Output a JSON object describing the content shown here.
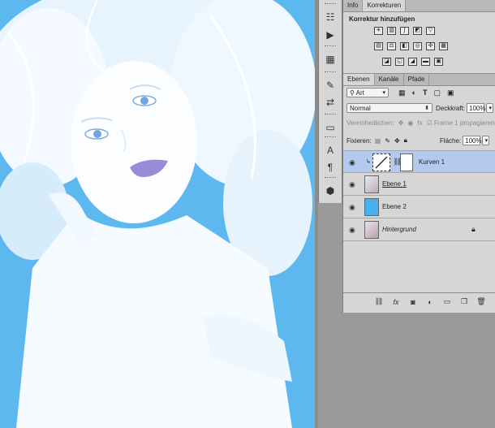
{
  "colors": {
    "canvas_bg": "#5db8f0",
    "panel_bg": "#d6d6d6",
    "selection": "#b3c9ee"
  },
  "tool_icons": [
    "actions-icon",
    "play-icon",
    "brush-preset-icon",
    "clone-source-icon",
    "character-icon",
    "paragraph-icon",
    "3d-icon"
  ],
  "top_panel": {
    "tabs": [
      "Info",
      "Korrekturen"
    ],
    "active_tab": "Korrekturen",
    "title": "Korrektur hinzufügen",
    "row1_icons": [
      "brightness-icon",
      "levels-icon",
      "curves-icon",
      "exposure-icon",
      "vibrance-icon"
    ],
    "row2_icons": [
      "hue-saturation-icon",
      "color-balance-icon",
      "black-white-icon",
      "photo-filter-icon",
      "channel-mixer-icon",
      "color-lookup-icon"
    ],
    "row3_icons": [
      "invert-icon",
      "posterize-icon",
      "threshold-icon",
      "gradient-map-icon",
      "selective-color-icon"
    ]
  },
  "layers_panel": {
    "tabs": [
      "Ebenen",
      "Kanäle",
      "Pfade"
    ],
    "active_tab": "Ebenen",
    "filter_kind": "Art",
    "blend_mode": "Normal",
    "opacity_label": "Deckkraft:",
    "opacity_value": "100%",
    "unify_label": "Vereinheitlichen:",
    "propagate_label": "Frame 1 propagieren",
    "lock_label": "Fixieren:",
    "fill_label": "Fläche:",
    "fill_value": "100%",
    "layers": [
      {
        "name": "Kurven 1",
        "type": "adjustment",
        "selected": true
      },
      {
        "name": "Ebene 1",
        "type": "photo",
        "selected": false
      },
      {
        "name": "Ebene 2",
        "type": "fill",
        "selected": false
      },
      {
        "name": "Hintergrund",
        "type": "background",
        "selected": false,
        "locked": true
      }
    ],
    "footer_icons": [
      "link-icon",
      "fx-icon",
      "mask-icon",
      "adjustment-layer-icon",
      "group-icon",
      "new-layer-icon",
      "trash-icon"
    ]
  }
}
